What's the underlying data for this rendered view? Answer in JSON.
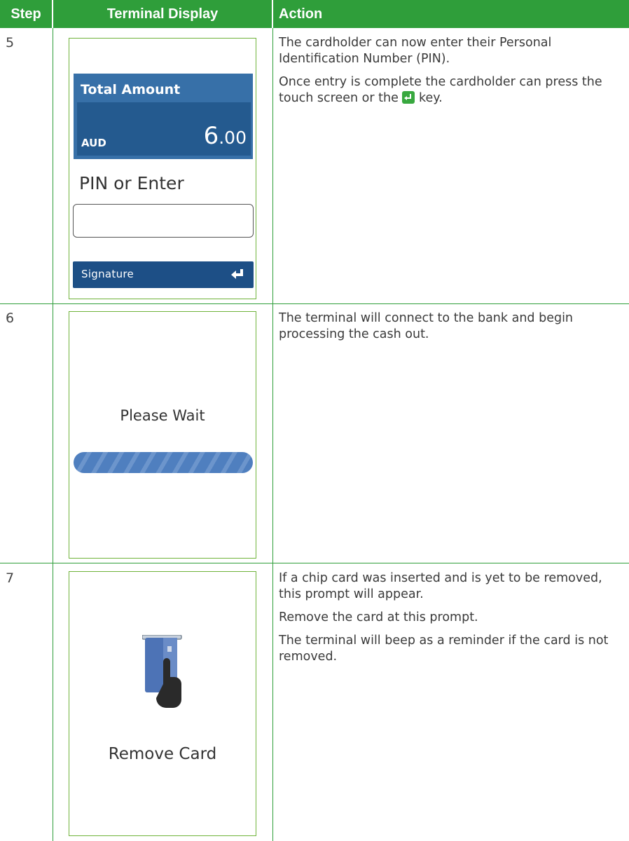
{
  "table": {
    "headers": {
      "step": "Step",
      "display": "Terminal Display",
      "action": "Action"
    }
  },
  "rows": [
    {
      "step": "5",
      "screen": {
        "amount_title": "Total Amount",
        "currency": "AUD",
        "amount_whole": "6",
        "amount_decimal": ".00",
        "prompt": "PIN or Enter",
        "pin_value": "",
        "button_label": "Signature",
        "button_icon": "enter-arrow-icon"
      },
      "action": [
        "The cardholder can now enter their Personal Identification Number (PIN).",
        "Once entry is complete the cardholder can press the touch screen or the",
        "key."
      ]
    },
    {
      "step": "6",
      "screen": {
        "message": "Please Wait",
        "indicator": "progress-bar"
      },
      "action": [
        "The terminal will connect to the bank and begin processing the cash out."
      ]
    },
    {
      "step": "7",
      "screen": {
        "message": "Remove Card",
        "icon": "remove-card-icon"
      },
      "action": [
        "If a chip card was inserted and is yet to be removed, this prompt will appear.",
        "Remove the card at this prompt.",
        "The terminal will beep as a reminder if the card is not removed."
      ]
    }
  ],
  "colors": {
    "header_green": "#2f9e3a",
    "amount_blue": "#3770a8",
    "button_blue": "#1d4f86",
    "key_green": "#38a83f"
  }
}
